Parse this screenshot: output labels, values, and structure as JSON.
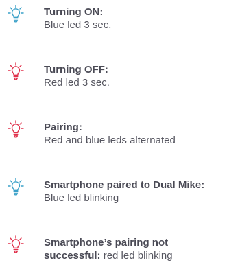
{
  "colors": {
    "blue": "#3aa0c8",
    "red": "#e0314b",
    "text": "#4a4a55"
  },
  "items": [
    {
      "icon": "lightbulb-blue-icon",
      "title": "Turning ON:",
      "description": "Blue led 3 sec."
    },
    {
      "icon": "lightbulb-red-icon",
      "title": "Turning OFF:",
      "description": "Red led 3 sec."
    },
    {
      "icon": "lightbulb-red-icon",
      "title": "Pairing:",
      "description": "Red and blue leds alternated"
    },
    {
      "icon": "lightbulb-blue-icon",
      "title": "Smartphone paired to Dual Mike:",
      "description": "Blue led blinking"
    },
    {
      "icon": "lightbulb-red-icon",
      "title_line1": "Smartphone’s pairing not",
      "title_line2": "successful:",
      "description": " red led blinking"
    }
  ]
}
